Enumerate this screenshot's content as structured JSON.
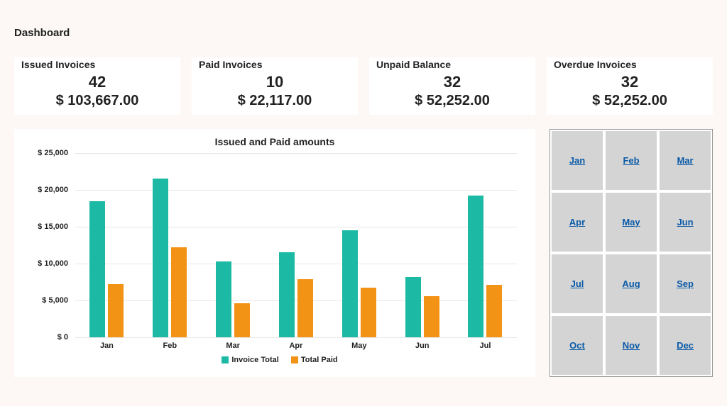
{
  "title": "Dashboard",
  "metrics": [
    {
      "label": "Issued Invoices",
      "count": "42",
      "amount": "$ 103,667.00"
    },
    {
      "label": "Paid Invoices",
      "count": "10",
      "amount": "$ 22,117.00"
    },
    {
      "label": "Unpaid Balance",
      "count": "32",
      "amount": "$ 52,252.00"
    },
    {
      "label": "Overdue Invoices",
      "count": "32",
      "amount": "$ 52,252.00"
    }
  ],
  "chart_data": {
    "type": "bar",
    "title": "Issued and Paid amounts",
    "categories": [
      "Jan",
      "Feb",
      "Mar",
      "Apr",
      "May",
      "Jun",
      "Jul"
    ],
    "series": [
      {
        "name": "Invoice Total",
        "color": "#1cbaa5",
        "values": [
          18500,
          21500,
          10300,
          11500,
          14500,
          8200,
          19200
        ]
      },
      {
        "name": "Total Paid",
        "color": "#f39315",
        "values": [
          7200,
          12200,
          4600,
          7900,
          6700,
          5600,
          7100
        ]
      }
    ],
    "ylabel": "",
    "xlabel": "",
    "ylim": [
      0,
      25000
    ],
    "y_ticks": [
      "$ 0",
      "$ 5,000",
      "$ 10,000",
      "$ 15,000",
      "$ 20,000",
      "$ 25,000"
    ]
  },
  "month_slicer": [
    "Jan",
    "Feb",
    "Mar",
    "Apr",
    "May",
    "Jun",
    "Jul",
    "Aug",
    "Sep",
    "Oct",
    "Nov",
    "Dec"
  ]
}
